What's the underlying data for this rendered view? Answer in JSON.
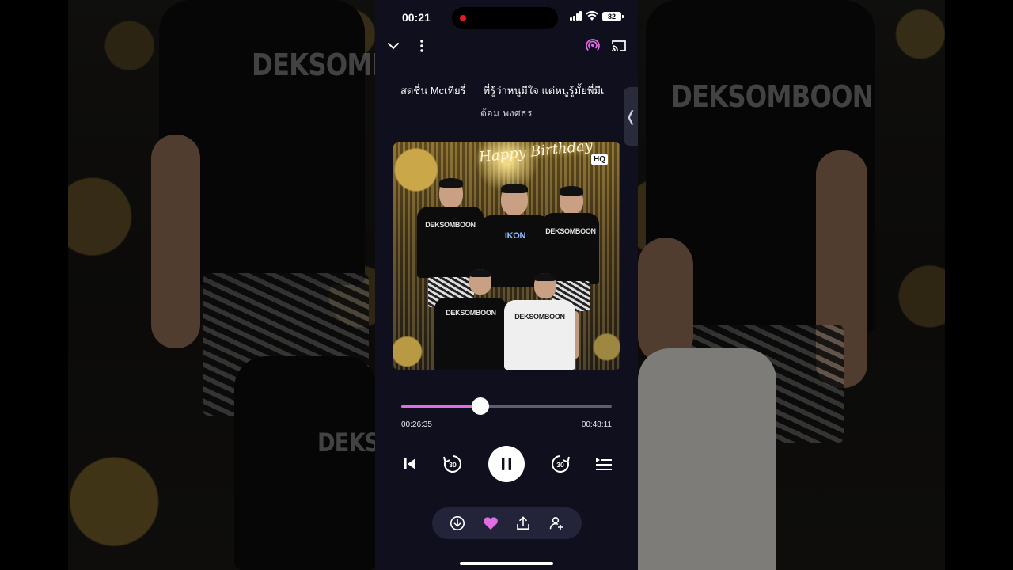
{
  "status_bar": {
    "time": "00:21",
    "battery": "82"
  },
  "track": {
    "title_parts": [
      "สดชื่น Mcเทียรี่",
      "พี่รู้ว่าหนูมีใจ แต่หนูรู้มั้ยพี่มีเ"
    ],
    "artist": "ต้อม พงศธร",
    "quality_badge": "HQ",
    "artwork_sign": "Happy Birthday",
    "artwork_shirt_text": "DEKSOMBOON"
  },
  "playback": {
    "elapsed": "00:26:35",
    "total": "00:48:11",
    "progress_fraction": 0.376,
    "state": "playing",
    "rewind_seconds": "30",
    "forward_seconds": "30"
  },
  "actions": {
    "liked": true
  },
  "colors": {
    "accent": "#e06de6",
    "background": "#0f0f1d",
    "pill": "#23243a"
  },
  "icons": [
    "chevron-down-icon",
    "more-vertical-icon",
    "podcast-icon",
    "cast-icon",
    "side-panel-chevron-icon",
    "skip-previous-icon",
    "rewind-30-icon",
    "pause-icon",
    "forward-30-icon",
    "queue-icon",
    "download-icon",
    "heart-icon",
    "share-icon",
    "add-user-icon"
  ]
}
